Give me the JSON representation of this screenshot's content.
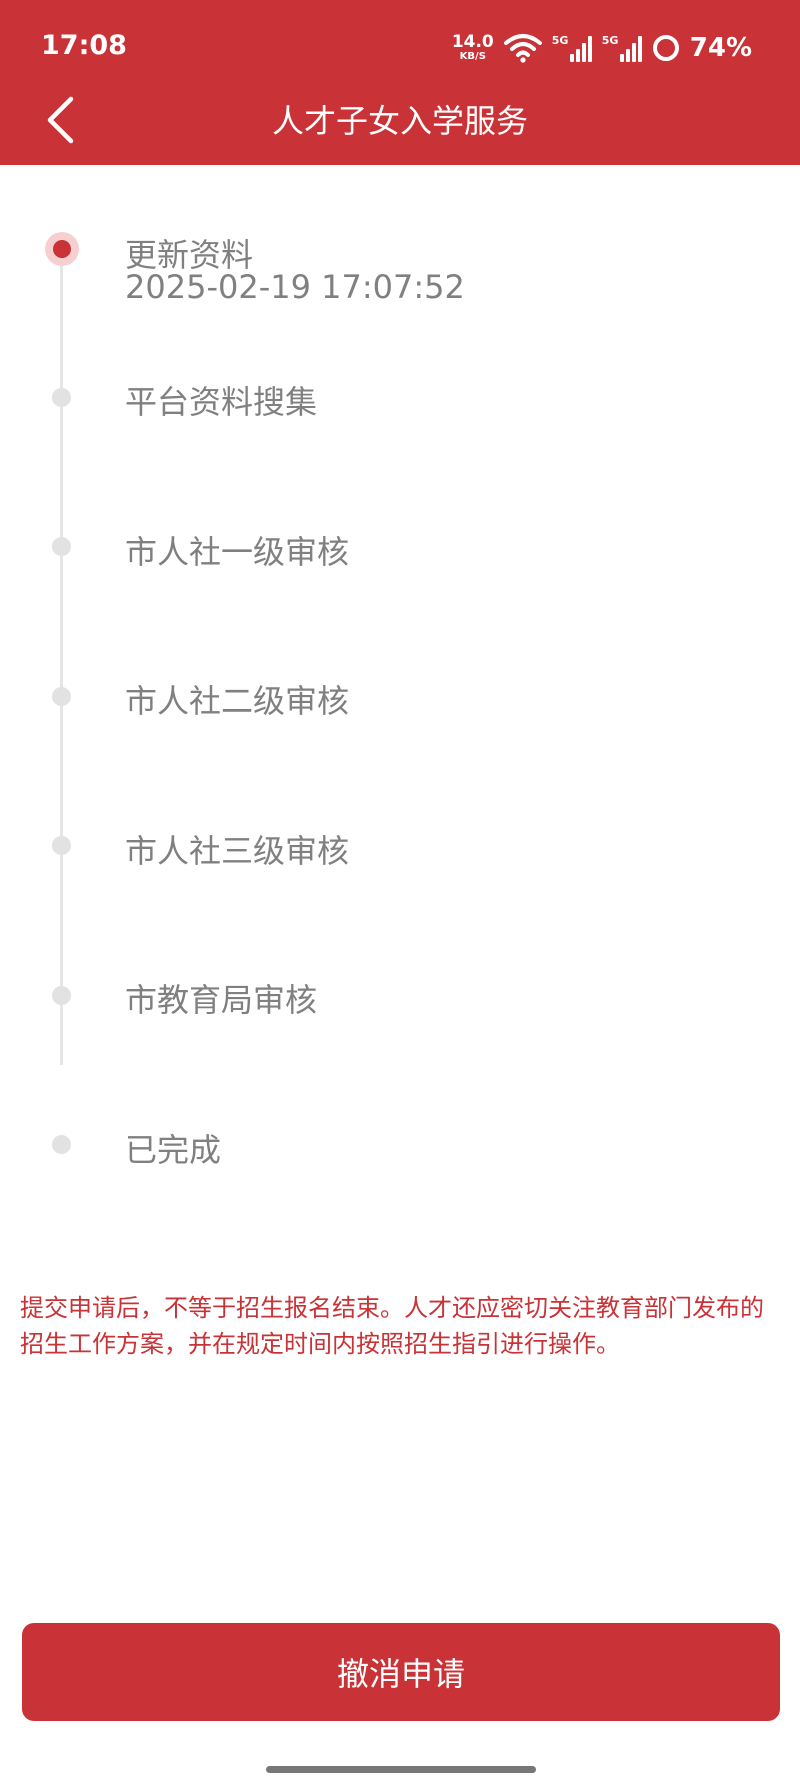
{
  "status_bar": {
    "time": "17:08",
    "speed_value": "14.0",
    "speed_unit": "KB/S",
    "sim1_label": "5G",
    "sim2_label": "5G",
    "battery": "74%"
  },
  "nav": {
    "title": "人才子女入学服务"
  },
  "timeline": {
    "steps": [
      {
        "label": "更新资料",
        "time": "2025-02-19 17:07:52",
        "active": true
      },
      {
        "label": "平台资料搜集",
        "time": "",
        "active": false
      },
      {
        "label": "市人社一级审核",
        "time": "",
        "active": false
      },
      {
        "label": "市人社二级审核",
        "time": "",
        "active": false
      },
      {
        "label": "市人社三级审核",
        "time": "",
        "active": false
      },
      {
        "label": "市教育局审核",
        "time": "",
        "active": false
      },
      {
        "label": "已完成",
        "time": "",
        "active": false
      }
    ]
  },
  "notice": {
    "text": "提交申请后，不等于招生报名结束。人才还应密切关注教育部门发布的招生工作方案，并在规定时间内按照招生指引进行操作。"
  },
  "actions": {
    "cancel_label": "撤消申请"
  },
  "colors": {
    "brand": "#c93236",
    "step_text": "#808080",
    "timeline_inactive": "#e2e2e2"
  }
}
